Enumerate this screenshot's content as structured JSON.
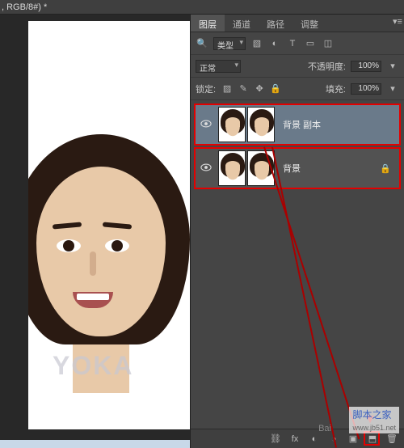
{
  "doc_tab": ", RGB/8#) *",
  "panel_tabs": {
    "layers": "图层",
    "channels": "通道",
    "paths": "路径",
    "adjust": "调整"
  },
  "filter_row": {
    "kind": "类型"
  },
  "blend_row": {
    "mode": "正常",
    "opacity_label": "不透明度:",
    "opacity_value": "100%"
  },
  "lock_row": {
    "lock_label": "锁定:",
    "fill_label": "填充:",
    "fill_value": "100%"
  },
  "layers": [
    {
      "name": "背景 副本",
      "locked": false
    },
    {
      "name": "背景",
      "locked": true
    }
  ],
  "footer_icons": {
    "link": "⛓",
    "fx": "fx",
    "mask": "◐",
    "adjust": "◑",
    "group": "▣",
    "new": "⬒",
    "trash": "🗑"
  },
  "canvas_watermark": "YOKA",
  "site_watermark": "脚本之家",
  "site_url": "www.jb51.net",
  "baidu": "Bai",
  "colors": {
    "highlight": "#e30000"
  }
}
